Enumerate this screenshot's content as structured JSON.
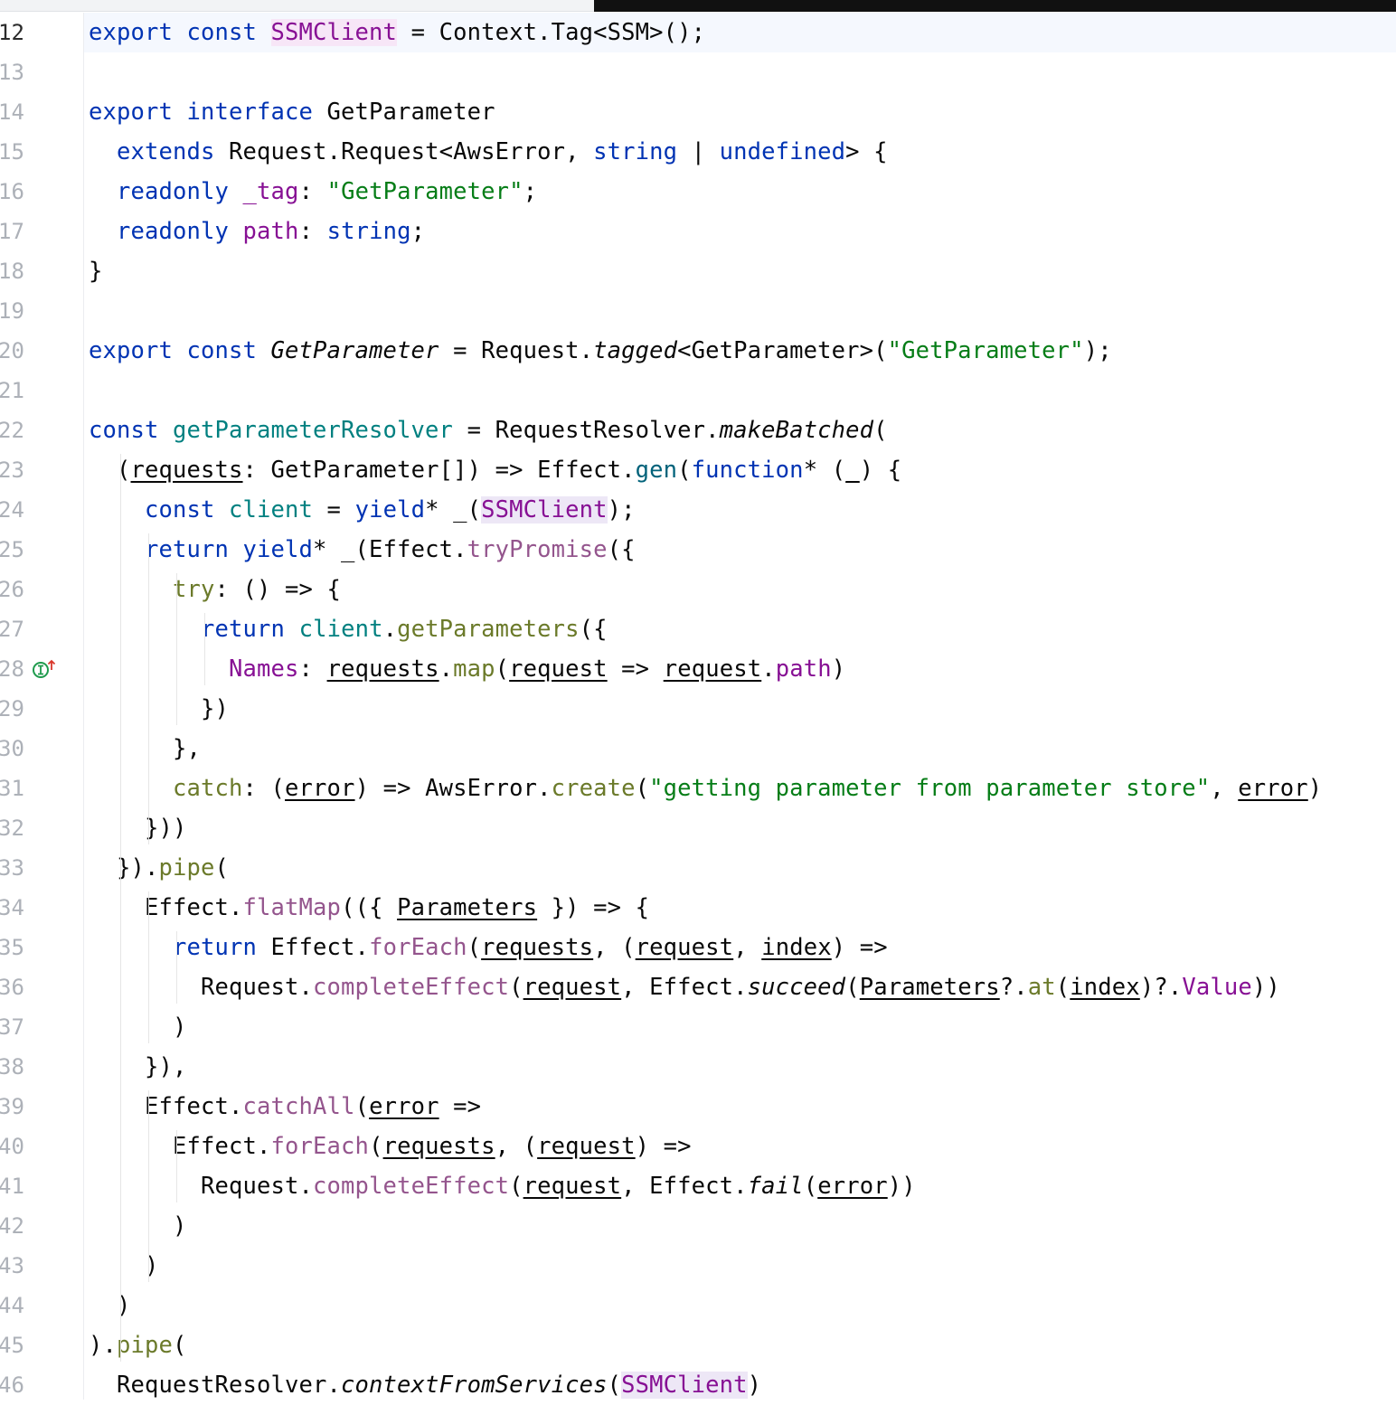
{
  "editor": {
    "current_line": 12,
    "lines": [
      {
        "n": "12",
        "segs": [
          [
            "k",
            "export const "
          ],
          [
            "p hl",
            "SSMClient"
          ],
          [
            "t",
            " = Context.Tag<SSM>();"
          ]
        ]
      },
      {
        "n": "13",
        "segs": []
      },
      {
        "n": "14",
        "segs": [
          [
            "k",
            "export interface "
          ],
          [
            "t",
            "GetParameter"
          ]
        ]
      },
      {
        "n": "15",
        "segs": [
          [
            "t",
            "  "
          ],
          [
            "k",
            "extends "
          ],
          [
            "t",
            "Request.Request<AwsError, "
          ],
          [
            "k",
            "string"
          ],
          [
            "t",
            " | "
          ],
          [
            "k",
            "undefined"
          ],
          [
            "t",
            "> {"
          ]
        ]
      },
      {
        "n": "16",
        "segs": [
          [
            "t",
            "  "
          ],
          [
            "k",
            "readonly "
          ],
          [
            "p",
            "_tag"
          ],
          [
            "t",
            ": "
          ],
          [
            "s",
            "\"GetParameter\""
          ],
          [
            "t",
            ";"
          ]
        ]
      },
      {
        "n": "17",
        "segs": [
          [
            "t",
            "  "
          ],
          [
            "k",
            "readonly "
          ],
          [
            "p",
            "path"
          ],
          [
            "t",
            ": "
          ],
          [
            "k",
            "string"
          ],
          [
            "t",
            ";"
          ]
        ]
      },
      {
        "n": "18",
        "segs": [
          [
            "t",
            "}"
          ]
        ]
      },
      {
        "n": "19",
        "segs": []
      },
      {
        "n": "20",
        "segs": [
          [
            "k",
            "export const "
          ],
          [
            "t i",
            "GetParameter"
          ],
          [
            "t",
            " = Request."
          ],
          [
            "t i",
            "tagged"
          ],
          [
            "t",
            "<GetParameter>("
          ],
          [
            "s",
            "\"GetParameter\""
          ],
          [
            "t",
            ");"
          ]
        ]
      },
      {
        "n": "21",
        "segs": []
      },
      {
        "n": "22",
        "segs": [
          [
            "k",
            "const "
          ],
          [
            "tp",
            "getParameterResolver"
          ],
          [
            "t",
            " = RequestResolver."
          ],
          [
            "t i",
            "makeBatched"
          ],
          [
            "t",
            "("
          ]
        ]
      },
      {
        "n": "23",
        "segs": [
          [
            "t",
            "  ("
          ],
          [
            "t u",
            "requests"
          ],
          [
            "t",
            ": GetParameter[]) => Effect."
          ],
          [
            "f",
            "gen"
          ],
          [
            "t",
            "("
          ],
          [
            "k",
            "function"
          ],
          [
            "t",
            "* ("
          ],
          [
            "t u",
            "_"
          ],
          [
            "t",
            ") {"
          ]
        ]
      },
      {
        "n": "24",
        "segs": [
          [
            "t",
            "    "
          ],
          [
            "k",
            "const "
          ],
          [
            "tp",
            "client"
          ],
          [
            "t",
            " = "
          ],
          [
            "k",
            "yield"
          ],
          [
            "t",
            "* _("
          ],
          [
            "p hl2",
            "SSMClient"
          ],
          [
            "t",
            ");"
          ]
        ]
      },
      {
        "n": "25",
        "segs": [
          [
            "t",
            "    "
          ],
          [
            "k",
            "return yield"
          ],
          [
            "t",
            "* _(Effect."
          ],
          [
            "mc",
            "tryPromise"
          ],
          [
            "t",
            "({"
          ]
        ]
      },
      {
        "n": "26",
        "segs": [
          [
            "t",
            "      "
          ],
          [
            "m",
            "try"
          ],
          [
            "t",
            ": () => {"
          ]
        ]
      },
      {
        "n": "27",
        "segs": [
          [
            "t",
            "        "
          ],
          [
            "k",
            "return "
          ],
          [
            "tp",
            "client"
          ],
          [
            "t",
            "."
          ],
          [
            "m",
            "getParameters"
          ],
          [
            "t",
            "({"
          ]
        ]
      },
      {
        "n": "28",
        "segs": [
          [
            "t",
            "          "
          ],
          [
            "p",
            "Names"
          ],
          [
            "t",
            ": "
          ],
          [
            "t u",
            "requests"
          ],
          [
            "t",
            "."
          ],
          [
            "m",
            "map"
          ],
          [
            "t",
            "("
          ],
          [
            "t u",
            "request"
          ],
          [
            "t",
            " => "
          ],
          [
            "t u",
            "request"
          ],
          [
            "t",
            "."
          ],
          [
            "p",
            "path"
          ],
          [
            "t",
            ")"
          ]
        ]
      },
      {
        "n": "29",
        "segs": [
          [
            "t",
            "        })"
          ]
        ]
      },
      {
        "n": "30",
        "segs": [
          [
            "t",
            "      },"
          ]
        ]
      },
      {
        "n": "31",
        "segs": [
          [
            "t",
            "      "
          ],
          [
            "m",
            "catch"
          ],
          [
            "t",
            ": ("
          ],
          [
            "t u",
            "error"
          ],
          [
            "t",
            ") => AwsError."
          ],
          [
            "m",
            "create"
          ],
          [
            "t",
            "("
          ],
          [
            "s",
            "\"getting parameter from parameter store\""
          ],
          [
            "t",
            ", "
          ],
          [
            "t u",
            "error"
          ],
          [
            "t",
            ")"
          ]
        ]
      },
      {
        "n": "32",
        "segs": [
          [
            "t",
            "    }))"
          ]
        ]
      },
      {
        "n": "33",
        "segs": [
          [
            "t",
            "  })."
          ],
          [
            "m",
            "pipe"
          ],
          [
            "t",
            "("
          ]
        ]
      },
      {
        "n": "34",
        "segs": [
          [
            "t",
            "    Effect."
          ],
          [
            "mc",
            "flatMap"
          ],
          [
            "t",
            "(({ "
          ],
          [
            "t u",
            "Parameters"
          ],
          [
            "t",
            " }) => {"
          ]
        ]
      },
      {
        "n": "35",
        "segs": [
          [
            "t",
            "      "
          ],
          [
            "k",
            "return "
          ],
          [
            "t",
            "Effect."
          ],
          [
            "mc",
            "forEach"
          ],
          [
            "t",
            "("
          ],
          [
            "t u",
            "requests"
          ],
          [
            "t",
            ", ("
          ],
          [
            "t u",
            "request"
          ],
          [
            "t",
            ", "
          ],
          [
            "t u",
            "index"
          ],
          [
            "t",
            ") =>"
          ]
        ]
      },
      {
        "n": "36",
        "segs": [
          [
            "t",
            "        Request."
          ],
          [
            "mc",
            "completeEffect"
          ],
          [
            "t",
            "("
          ],
          [
            "t u",
            "request"
          ],
          [
            "t",
            ", Effect."
          ],
          [
            "t i",
            "succeed"
          ],
          [
            "t",
            "("
          ],
          [
            "t u",
            "Parameters"
          ],
          [
            "t",
            "?."
          ],
          [
            "m",
            "at"
          ],
          [
            "t",
            "("
          ],
          [
            "t u",
            "index"
          ],
          [
            "t",
            ")?."
          ],
          [
            "p",
            "Value"
          ],
          [
            "t",
            "))"
          ]
        ]
      },
      {
        "n": "37",
        "segs": [
          [
            "t",
            "      )"
          ]
        ]
      },
      {
        "n": "38",
        "segs": [
          [
            "t",
            "    }),"
          ]
        ]
      },
      {
        "n": "39",
        "segs": [
          [
            "t",
            "    Effect."
          ],
          [
            "mc",
            "catchAll"
          ],
          [
            "t",
            "("
          ],
          [
            "t u",
            "error"
          ],
          [
            "t",
            " =>"
          ]
        ]
      },
      {
        "n": "40",
        "segs": [
          [
            "t",
            "      Effect."
          ],
          [
            "mc",
            "forEach"
          ],
          [
            "t",
            "("
          ],
          [
            "t u",
            "requests"
          ],
          [
            "t",
            ", ("
          ],
          [
            "t u",
            "request"
          ],
          [
            "t",
            ") =>"
          ]
        ]
      },
      {
        "n": "41",
        "segs": [
          [
            "t",
            "        Request."
          ],
          [
            "mc",
            "completeEffect"
          ],
          [
            "t",
            "("
          ],
          [
            "t u",
            "request"
          ],
          [
            "t",
            ", Effect."
          ],
          [
            "t i",
            "fail"
          ],
          [
            "t",
            "("
          ],
          [
            "t u",
            "error"
          ],
          [
            "t",
            "))"
          ]
        ]
      },
      {
        "n": "42",
        "segs": [
          [
            "t",
            "      )"
          ]
        ]
      },
      {
        "n": "43",
        "segs": [
          [
            "t",
            "    )"
          ]
        ]
      },
      {
        "n": "44",
        "segs": [
          [
            "t",
            "  )"
          ]
        ]
      },
      {
        "n": "45",
        "segs": [
          [
            "t",
            ")."
          ],
          [
            "m",
            "pipe"
          ],
          [
            "t",
            "("
          ]
        ]
      },
      {
        "n": "46",
        "segs": [
          [
            "t",
            "  RequestResolver."
          ],
          [
            "t i",
            "contextFromServices"
          ],
          [
            "t",
            "("
          ],
          [
            "p hl2",
            "SSMClient"
          ],
          [
            "t",
            ")"
          ]
        ]
      }
    ]
  },
  "gutter": {
    "implementation_marker_line": "28",
    "implementation_marker_icon": "implements-interface-icon",
    "colors": {
      "icon": "#1f9b4d",
      "arrow": "#d9372b"
    }
  }
}
